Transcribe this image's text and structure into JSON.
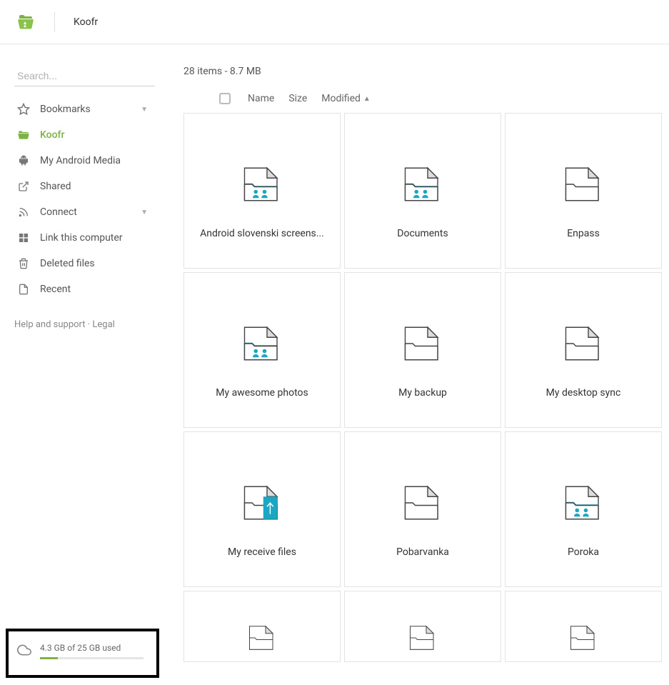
{
  "header": {
    "breadcrumb": "Koofr"
  },
  "search": {
    "placeholder": "Search..."
  },
  "sidebar": {
    "items": [
      {
        "label": "Bookmarks",
        "icon": "star-icon",
        "expandable": true
      },
      {
        "label": "Koofr",
        "icon": "koofr-icon",
        "active": true
      },
      {
        "label": "My Android Media",
        "icon": "android-icon"
      },
      {
        "label": "Shared",
        "icon": "external-icon"
      },
      {
        "label": "Connect",
        "icon": "rss-icon",
        "expandable": true
      },
      {
        "label": "Link this computer",
        "icon": "grid-icon"
      },
      {
        "label": "Deleted files",
        "icon": "trash-icon"
      },
      {
        "label": "Recent",
        "icon": "recent-icon"
      }
    ],
    "help_label": "Help and support",
    "legal_label": "Legal",
    "separator": " · "
  },
  "storage": {
    "text": "4.3 GB of 25 GB used",
    "percent": 17
  },
  "main": {
    "summary": "28 items - 8.7 MB",
    "columns": {
      "name": "Name",
      "size": "Size",
      "modified": "Modified"
    }
  },
  "files": [
    {
      "name": "Android slovenski screens...",
      "kind": "shared"
    },
    {
      "name": "Documents",
      "kind": "shared"
    },
    {
      "name": "Enpass",
      "kind": "folder"
    },
    {
      "name": "My awesome photos",
      "kind": "shared"
    },
    {
      "name": "My backup",
      "kind": "folder"
    },
    {
      "name": "My desktop sync",
      "kind": "folder"
    },
    {
      "name": "My receive files",
      "kind": "upload"
    },
    {
      "name": "Pobarvanka",
      "kind": "folder"
    },
    {
      "name": "Poroka",
      "kind": "shared"
    }
  ]
}
